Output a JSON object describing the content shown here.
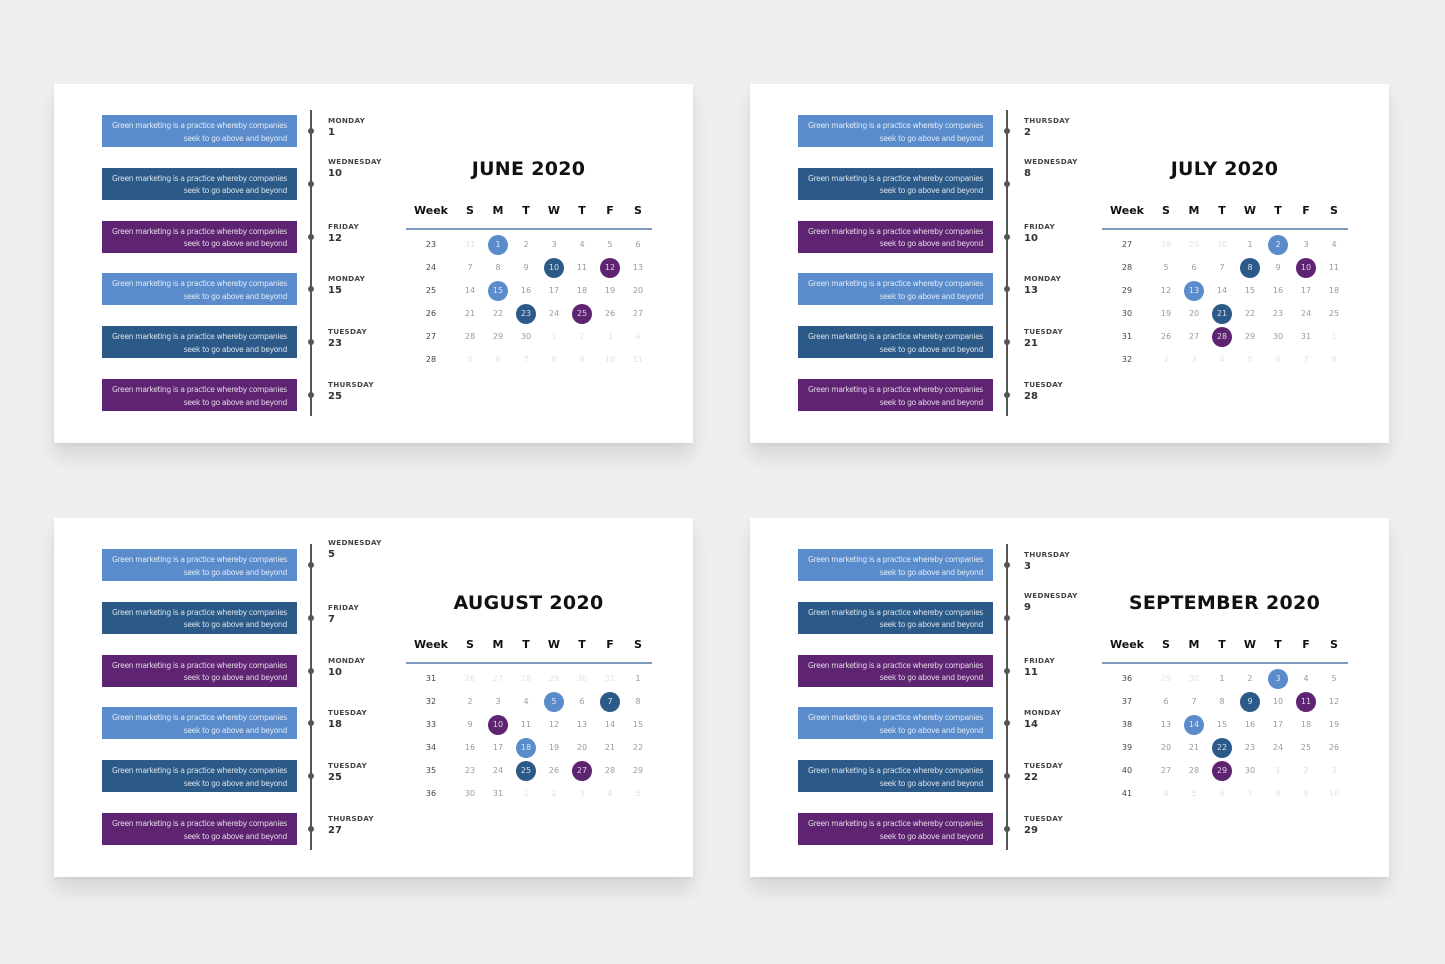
{
  "colors": {
    "light_blue": "#5a8ccc",
    "dark_blue": "#2c5a88",
    "purple": "#5e2371"
  },
  "box_text_line1": "Green marketing is a practice whereby companies",
  "box_text_line2": "seek to go above and beyond",
  "weekday_headers": [
    "Week",
    "S",
    "M",
    "T",
    "W",
    "T",
    "F",
    "S"
  ],
  "slides": [
    {
      "title": "JUNE 2020",
      "events": [
        {
          "day": "MONDAY",
          "date": "1",
          "color": "light_blue"
        },
        {
          "day": "WEDNESDAY",
          "date": "10",
          "color": "dark_blue"
        },
        {
          "day": "FRIDAY",
          "date": "12",
          "color": "purple"
        },
        {
          "day": "MONDAY",
          "date": "15",
          "color": "light_blue"
        },
        {
          "day": "TUESDAY",
          "date": "23",
          "color": "dark_blue"
        },
        {
          "day": "THURSDAY",
          "date": "25",
          "color": "purple"
        }
      ],
      "weeks": [
        {
          "week": "23",
          "days": [
            [
              "31",
              0
            ],
            [
              "1",
              1
            ],
            [
              "2",
              1
            ],
            [
              "3",
              1
            ],
            [
              "4",
              1
            ],
            [
              "5",
              1
            ],
            [
              "6",
              1
            ]
          ]
        },
        {
          "week": "24",
          "days": [
            [
              "7",
              1
            ],
            [
              "8",
              1
            ],
            [
              "9",
              1
            ],
            [
              "10",
              1
            ],
            [
              "11",
              1
            ],
            [
              "12",
              1
            ],
            [
              "13",
              1
            ]
          ]
        },
        {
          "week": "25",
          "days": [
            [
              "14",
              1
            ],
            [
              "15",
              1
            ],
            [
              "16",
              1
            ],
            [
              "17",
              1
            ],
            [
              "18",
              1
            ],
            [
              "19",
              1
            ],
            [
              "20",
              1
            ]
          ]
        },
        {
          "week": "26",
          "days": [
            [
              "21",
              1
            ],
            [
              "22",
              1
            ],
            [
              "23",
              1
            ],
            [
              "24",
              1
            ],
            [
              "25",
              1
            ],
            [
              "26",
              1
            ],
            [
              "27",
              1
            ]
          ]
        },
        {
          "week": "27",
          "days": [
            [
              "28",
              1
            ],
            [
              "29",
              1
            ],
            [
              "30",
              1
            ],
            [
              "1",
              0
            ],
            [
              "2",
              0
            ],
            [
              "3",
              0
            ],
            [
              "4",
              0
            ]
          ]
        },
        {
          "week": "28",
          "days": [
            [
              "5",
              0
            ],
            [
              "6",
              0
            ],
            [
              "7",
              0
            ],
            [
              "8",
              0
            ],
            [
              "9",
              0
            ],
            [
              "10",
              0
            ],
            [
              "11",
              0
            ]
          ]
        }
      ]
    },
    {
      "title": "JULY 2020",
      "events": [
        {
          "day": "THURSDAY",
          "date": "2",
          "color": "light_blue"
        },
        {
          "day": "WEDNESDAY",
          "date": "8",
          "color": "dark_blue"
        },
        {
          "day": "FRIDAY",
          "date": "10",
          "color": "purple"
        },
        {
          "day": "MONDAY",
          "date": "13",
          "color": "light_blue"
        },
        {
          "day": "TUESDAY",
          "date": "21",
          "color": "dark_blue"
        },
        {
          "day": "TUESDAY",
          "date": "28",
          "color": "purple"
        }
      ],
      "weeks": [
        {
          "week": "27",
          "days": [
            [
              "28",
              0
            ],
            [
              "29",
              0
            ],
            [
              "30",
              0
            ],
            [
              "1",
              1
            ],
            [
              "2",
              1
            ],
            [
              "3",
              1
            ],
            [
              "4",
              1
            ]
          ]
        },
        {
          "week": "28",
          "days": [
            [
              "5",
              1
            ],
            [
              "6",
              1
            ],
            [
              "7",
              1
            ],
            [
              "8",
              1
            ],
            [
              "9",
              1
            ],
            [
              "10",
              1
            ],
            [
              "11",
              1
            ]
          ]
        },
        {
          "week": "29",
          "days": [
            [
              "12",
              1
            ],
            [
              "13",
              1
            ],
            [
              "14",
              1
            ],
            [
              "15",
              1
            ],
            [
              "16",
              1
            ],
            [
              "17",
              1
            ],
            [
              "18",
              1
            ]
          ]
        },
        {
          "week": "30",
          "days": [
            [
              "19",
              1
            ],
            [
              "20",
              1
            ],
            [
              "21",
              1
            ],
            [
              "22",
              1
            ],
            [
              "23",
              1
            ],
            [
              "24",
              1
            ],
            [
              "25",
              1
            ]
          ]
        },
        {
          "week": "31",
          "days": [
            [
              "26",
              1
            ],
            [
              "27",
              1
            ],
            [
              "28",
              1
            ],
            [
              "29",
              1
            ],
            [
              "30",
              1
            ],
            [
              "31",
              1
            ],
            [
              "1",
              0
            ]
          ]
        },
        {
          "week": "32",
          "days": [
            [
              "2",
              0
            ],
            [
              "3",
              0
            ],
            [
              "4",
              0
            ],
            [
              "5",
              0
            ],
            [
              "6",
              0
            ],
            [
              "7",
              0
            ],
            [
              "8",
              0
            ]
          ]
        }
      ]
    },
    {
      "title": "AUGUST 2020",
      "events": [
        {
          "day": "WEDNESDAY",
          "date": "5",
          "color": "light_blue"
        },
        {
          "day": "FRIDAY",
          "date": "7",
          "color": "dark_blue"
        },
        {
          "day": "MONDAY",
          "date": "10",
          "color": "purple"
        },
        {
          "day": "TUESDAY",
          "date": "18",
          "color": "light_blue"
        },
        {
          "day": "TUESDAY",
          "date": "25",
          "color": "dark_blue"
        },
        {
          "day": "THURSDAY",
          "date": "27",
          "color": "purple"
        }
      ],
      "weeks": [
        {
          "week": "31",
          "days": [
            [
              "26",
              0
            ],
            [
              "27",
              0
            ],
            [
              "28",
              0
            ],
            [
              "29",
              0
            ],
            [
              "30",
              0
            ],
            [
              "31",
              0
            ],
            [
              "1",
              1
            ]
          ]
        },
        {
          "week": "32",
          "days": [
            [
              "2",
              1
            ],
            [
              "3",
              1
            ],
            [
              "4",
              1
            ],
            [
              "5",
              1
            ],
            [
              "6",
              1
            ],
            [
              "7",
              1
            ],
            [
              "8",
              1
            ]
          ]
        },
        {
          "week": "33",
          "days": [
            [
              "9",
              1
            ],
            [
              "10",
              1
            ],
            [
              "11",
              1
            ],
            [
              "12",
              1
            ],
            [
              "13",
              1
            ],
            [
              "14",
              1
            ],
            [
              "15",
              1
            ]
          ]
        },
        {
          "week": "34",
          "days": [
            [
              "16",
              1
            ],
            [
              "17",
              1
            ],
            [
              "18",
              1
            ],
            [
              "19",
              1
            ],
            [
              "20",
              1
            ],
            [
              "21",
              1
            ],
            [
              "22",
              1
            ]
          ]
        },
        {
          "week": "35",
          "days": [
            [
              "23",
              1
            ],
            [
              "24",
              1
            ],
            [
              "25",
              1
            ],
            [
              "26",
              1
            ],
            [
              "27",
              1
            ],
            [
              "28",
              1
            ],
            [
              "29",
              1
            ]
          ]
        },
        {
          "week": "36",
          "days": [
            [
              "30",
              1
            ],
            [
              "31",
              1
            ],
            [
              "1",
              0
            ],
            [
              "2",
              0
            ],
            [
              "3",
              0
            ],
            [
              "4",
              0
            ],
            [
              "5",
              0
            ]
          ]
        }
      ]
    },
    {
      "title": "SEPTEMBER 2020",
      "events": [
        {
          "day": "THURSDAY",
          "date": "3",
          "color": "light_blue"
        },
        {
          "day": "WEDNESDAY",
          "date": "9",
          "color": "dark_blue"
        },
        {
          "day": "FRIDAY",
          "date": "11",
          "color": "purple"
        },
        {
          "day": "MONDAY",
          "date": "14",
          "color": "light_blue"
        },
        {
          "day": "TUESDAY",
          "date": "22",
          "color": "dark_blue"
        },
        {
          "day": "TUESDAY",
          "date": "29",
          "color": "purple"
        }
      ],
      "weeks": [
        {
          "week": "36",
          "days": [
            [
              "29",
              0
            ],
            [
              "30",
              0
            ],
            [
              "1",
              1
            ],
            [
              "2",
              1
            ],
            [
              "3",
              1
            ],
            [
              "4",
              1
            ],
            [
              "5",
              1
            ]
          ]
        },
        {
          "week": "37",
          "days": [
            [
              "6",
              1
            ],
            [
              "7",
              1
            ],
            [
              "8",
              1
            ],
            [
              "9",
              1
            ],
            [
              "10",
              1
            ],
            [
              "11",
              1
            ],
            [
              "12",
              1
            ]
          ]
        },
        {
          "week": "38",
          "days": [
            [
              "13",
              1
            ],
            [
              "14",
              1
            ],
            [
              "15",
              1
            ],
            [
              "16",
              1
            ],
            [
              "17",
              1
            ],
            [
              "18",
              1
            ],
            [
              "19",
              1
            ]
          ]
        },
        {
          "week": "39",
          "days": [
            [
              "20",
              1
            ],
            [
              "21",
              1
            ],
            [
              "22",
              1
            ],
            [
              "23",
              1
            ],
            [
              "24",
              1
            ],
            [
              "25",
              1
            ],
            [
              "26",
              1
            ]
          ]
        },
        {
          "week": "40",
          "days": [
            [
              "27",
              1
            ],
            [
              "28",
              1
            ],
            [
              "29",
              1
            ],
            [
              "30",
              1
            ],
            [
              "1",
              0
            ],
            [
              "2",
              0
            ],
            [
              "3",
              0
            ]
          ]
        },
        {
          "week": "41",
          "days": [
            [
              "4",
              0
            ],
            [
              "5",
              0
            ],
            [
              "6",
              0
            ],
            [
              "7",
              0
            ],
            [
              "8",
              0
            ],
            [
              "9",
              0
            ],
            [
              "10",
              0
            ]
          ]
        }
      ]
    }
  ]
}
